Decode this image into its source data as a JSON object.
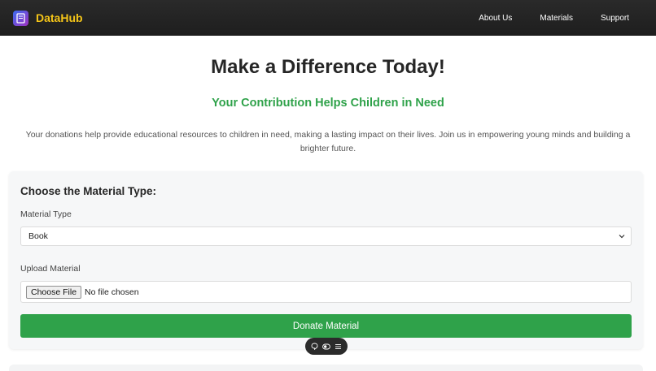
{
  "navbar": {
    "brand": "DataHub",
    "links": [
      "About Us",
      "Materials",
      "Support"
    ]
  },
  "hero": {
    "title": "Make a Difference Today!",
    "subtitle": "Your Contribution Helps Children in Need",
    "description": "Your donations help provide educational resources to children in need, making a lasting impact on their lives. Join us in empowering young minds and building a brighter future."
  },
  "form": {
    "heading": "Choose the Material Type:",
    "material_type_label": "Material Type",
    "material_type_value": "Book",
    "upload_label": "Upload Material",
    "choose_file_label": "Choose File",
    "file_status": "No file chosen",
    "submit_label": "Donate Material"
  },
  "colors": {
    "accent_green": "#2fa24a",
    "brand_yellow": "#f5c518",
    "navbar_bg": "#1e1e1e"
  },
  "icons": {
    "brand": "book-logo-icon",
    "select": "chevron-down-icon",
    "toolbar": [
      "chat-bubble-icon",
      "toggle-icon",
      "menu-icon"
    ]
  }
}
